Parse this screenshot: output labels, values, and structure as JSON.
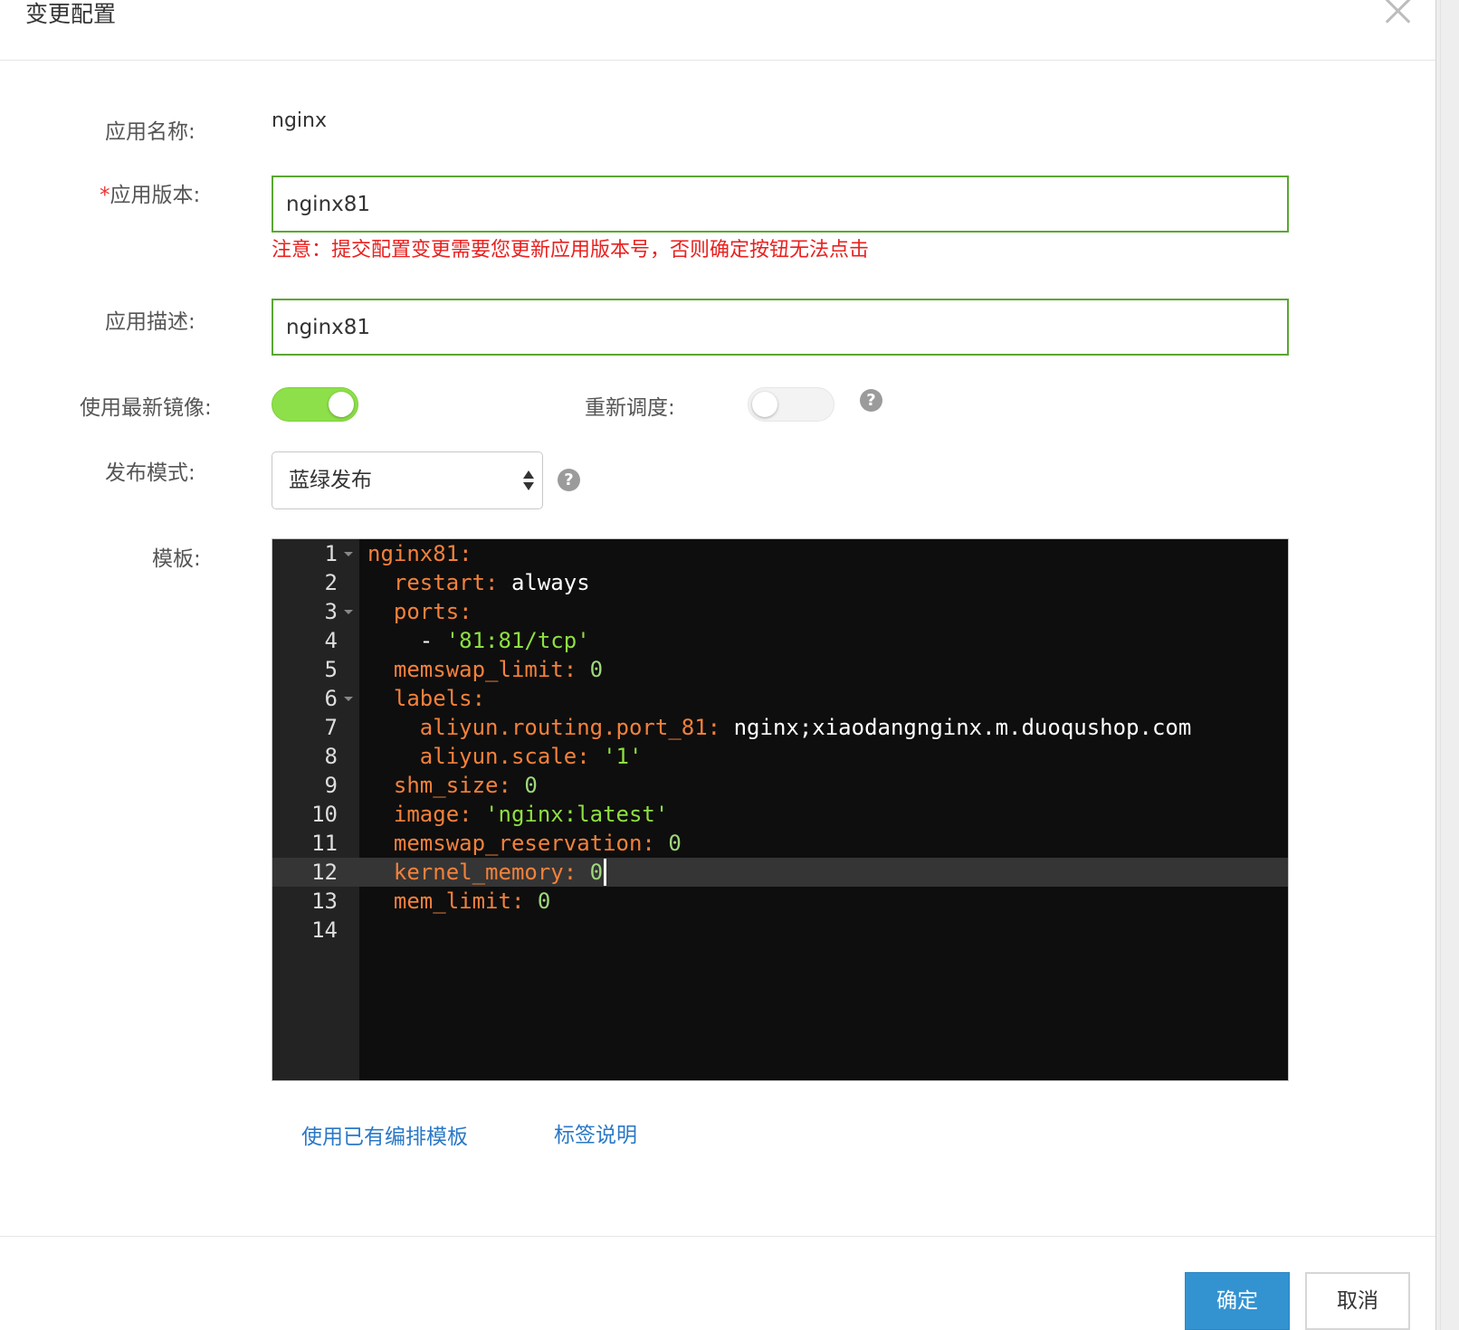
{
  "dialog": {
    "title": "变更配置",
    "close_icon": "close-icon"
  },
  "form": {
    "app_name": {
      "label": "应用名称:",
      "value": "nginx"
    },
    "app_version": {
      "required_mark": "*",
      "label": "应用版本:",
      "value": "nginx81"
    },
    "warning": "注意：提交配置变更需要您更新应用版本号，否则确定按钮无法点击",
    "app_desc": {
      "label": "应用描述:",
      "value": "nginx81"
    },
    "use_latest_image": {
      "label": "使用最新镜像:",
      "enabled": true
    },
    "reschedule": {
      "label": "重新调度:",
      "enabled": false
    },
    "help_glyph": "?",
    "release_mode": {
      "label": "发布模式:",
      "value": "蓝绿发布"
    },
    "template": {
      "label": "模板:"
    }
  },
  "editor": {
    "active_line": 12,
    "lines": [
      {
        "n": "1",
        "fold": true,
        "tokens": [
          {
            "t": "nginx81:",
            "c": "k"
          }
        ]
      },
      {
        "n": "2",
        "fold": false,
        "tokens": [
          {
            "t": "  restart:",
            "c": "k"
          },
          {
            "t": " always",
            "c": "w"
          }
        ]
      },
      {
        "n": "3",
        "fold": true,
        "tokens": [
          {
            "t": "  ports:",
            "c": "k"
          }
        ]
      },
      {
        "n": "4",
        "fold": false,
        "tokens": [
          {
            "t": "    -",
            "c": "w"
          },
          {
            "t": " '81:81/tcp'",
            "c": "s"
          }
        ]
      },
      {
        "n": "5",
        "fold": false,
        "tokens": [
          {
            "t": "  memswap_limit:",
            "c": "k"
          },
          {
            "t": " 0",
            "c": "n"
          }
        ]
      },
      {
        "n": "6",
        "fold": true,
        "tokens": [
          {
            "t": "  labels:",
            "c": "k"
          }
        ]
      },
      {
        "n": "7",
        "fold": false,
        "tokens": [
          {
            "t": "    aliyun.routing.port_81:",
            "c": "k"
          },
          {
            "t": " nginx;xiaodangnginx.m.duoqushop.com",
            "c": "w"
          }
        ]
      },
      {
        "n": "8",
        "fold": false,
        "tokens": [
          {
            "t": "    aliyun.scale:",
            "c": "k"
          },
          {
            "t": " '1'",
            "c": "s"
          }
        ]
      },
      {
        "n": "9",
        "fold": false,
        "tokens": [
          {
            "t": "  shm_size:",
            "c": "k"
          },
          {
            "t": " 0",
            "c": "n"
          }
        ]
      },
      {
        "n": "10",
        "fold": false,
        "tokens": [
          {
            "t": "  image:",
            "c": "k"
          },
          {
            "t": " 'nginx:latest'",
            "c": "s"
          }
        ]
      },
      {
        "n": "11",
        "fold": false,
        "tokens": [
          {
            "t": "  memswap_reservation:",
            "c": "k"
          },
          {
            "t": " 0",
            "c": "n"
          }
        ]
      },
      {
        "n": "12",
        "fold": false,
        "tokens": [
          {
            "t": "  kernel_memory:",
            "c": "k"
          },
          {
            "t": " 0",
            "c": "n"
          }
        ]
      },
      {
        "n": "13",
        "fold": false,
        "tokens": [
          {
            "t": "  mem_limit:",
            "c": "k"
          },
          {
            "t": " 0",
            "c": "n"
          }
        ]
      },
      {
        "n": "14",
        "fold": false,
        "tokens": []
      }
    ]
  },
  "links": {
    "use_template": "使用已有编排模板",
    "label_help": "标签说明"
  },
  "footer": {
    "confirm": "确定",
    "cancel": "取消"
  },
  "colors": {
    "accent": "#3393d1",
    "toggle_on": "#8ee04a",
    "input_border": "#5aa732",
    "warning": "#e8211f",
    "link": "#2a78c7"
  }
}
